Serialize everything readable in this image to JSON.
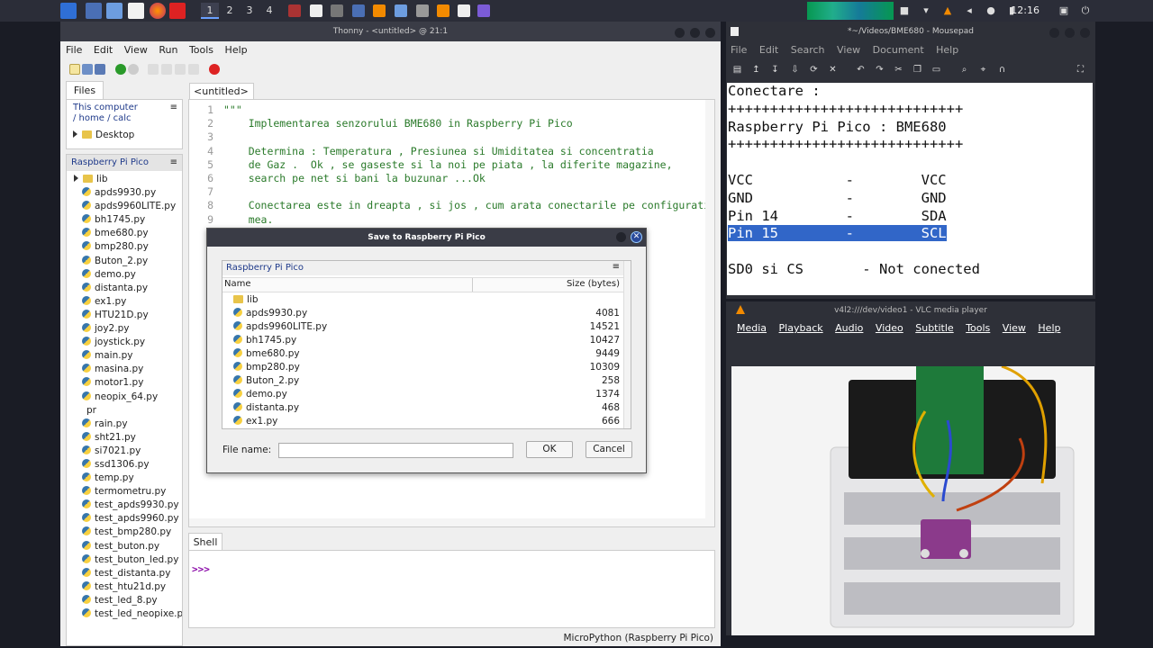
{
  "taskbar": {
    "workspaces": [
      "1",
      "2",
      "3",
      "4"
    ],
    "clock": "12:16",
    "icons": [
      "app-menu-icon",
      "desktop-icon",
      "file-manager-icon",
      "text-editor-icon",
      "firefox-icon",
      "terminal-icon",
      "thonny-icon",
      "mousepad-icon",
      "vlc-icon",
      "audio-waveform-icon",
      "camera-icon",
      "wifi-icon",
      "vlc-tray-icon",
      "volume-icon",
      "bell-icon",
      "battery-icon",
      "lock-icon",
      "power-icon"
    ]
  },
  "thonny": {
    "title": "Thonny - <untitled> @ 21:1",
    "menu": [
      "File",
      "Edit",
      "View",
      "Run",
      "Tools",
      "Help"
    ],
    "files_tab": "Files",
    "this_computer": "This computer",
    "path": "/ home / calc",
    "desktop": "Desktop",
    "pico_title": "Raspberry Pi Pico",
    "pico_files": [
      "lib",
      "apds9930.py",
      "apds9960LITE.py",
      "bh1745.py",
      "bme680.py",
      "bmp280.py",
      "Buton_2.py",
      "demo.py",
      "distanta.py",
      "ex1.py",
      "HTU21D.py",
      "joy2.py",
      "joystick.py",
      "main.py",
      "masina.py",
      "motor1.py",
      "neopix_64.py",
      "pr",
      "rain.py",
      "sht21.py",
      "si7021.py",
      "ssd1306.py",
      "temp.py",
      "termometru.py",
      "test_apds9930.py",
      "test_apds9960.py",
      "test_bmp280.py",
      "test_buton.py",
      "test_buton_led.py",
      "test_distanta.py",
      "test_htu21d.py",
      "test_led_8.py",
      "test_led_neopixe.p"
    ],
    "editor_tab": "<untitled> *",
    "line_numbers": [
      "1",
      "2",
      "3",
      "4",
      "5",
      "6",
      "7",
      "8",
      "9"
    ],
    "code_lines": [
      "\"\"\"",
      "    Implementarea senzorului BME680 in Raspberry Pi Pico",
      "",
      "    Determina : Temperatura , Presiunea si Umiditatea si concentratia",
      "    de Gaz .  Ok , se gaseste si la noi pe piata , la diferite magazine,",
      "    search pe net si bani la buzunar ...Ok",
      "",
      "    Conectarea este in dreapta , si jos , cum arata conectarile pe configurati",
      "    mea."
    ],
    "shell_tab": "Shell",
    "prompt": ">>>",
    "status": "MicroPython (Raspberry Pi Pico)"
  },
  "dialog": {
    "title": "Save to Raspberry Pi Pico",
    "location": "Raspberry Pi Pico",
    "col_name": "Name",
    "col_size": "Size (bytes)",
    "files": [
      {
        "name": "lib",
        "size": ""
      },
      {
        "name": "apds9930.py",
        "size": "4081"
      },
      {
        "name": "apds9960LITE.py",
        "size": "14521"
      },
      {
        "name": "bh1745.py",
        "size": "10427"
      },
      {
        "name": "bme680.py",
        "size": "9449"
      },
      {
        "name": "bmp280.py",
        "size": "10309"
      },
      {
        "name": "Buton_2.py",
        "size": "258"
      },
      {
        "name": "demo.py",
        "size": "1374"
      },
      {
        "name": "distanta.py",
        "size": "468"
      },
      {
        "name": "ex1.py",
        "size": "666"
      }
    ],
    "filename_label": "File name:",
    "filename_value": "",
    "ok": "OK",
    "cancel": "Cancel"
  },
  "mousepad": {
    "title": "*~/Videos/BME680 - Mousepad",
    "menu": [
      "File",
      "Edit",
      "Search",
      "View",
      "Document",
      "Help"
    ],
    "lines": [
      "Conectare :",
      "++++++++++++++++++++++++++++",
      "Raspberry Pi Pico : BME680",
      "++++++++++++++++++++++++++++",
      "",
      "VCC           -        VCC",
      "GND           -        GND",
      "Pin 14        -        SDA",
      "Pin 15        -        SCL",
      "",
      "SD0 si CS       - Not conected"
    ],
    "selected_line_index": 8
  },
  "vlc": {
    "title": "v4l2:///dev/video1 - VLC media player",
    "menu": [
      "Media",
      "Playback",
      "Audio",
      "Video",
      "Subtitle",
      "Tools",
      "View",
      "Help"
    ]
  },
  "colors": {
    "accent": "#3166c8",
    "code_green": "#2a7a2a",
    "panel_title_blue": "#1f3a8a",
    "dark_chrome": "#2e3038"
  }
}
